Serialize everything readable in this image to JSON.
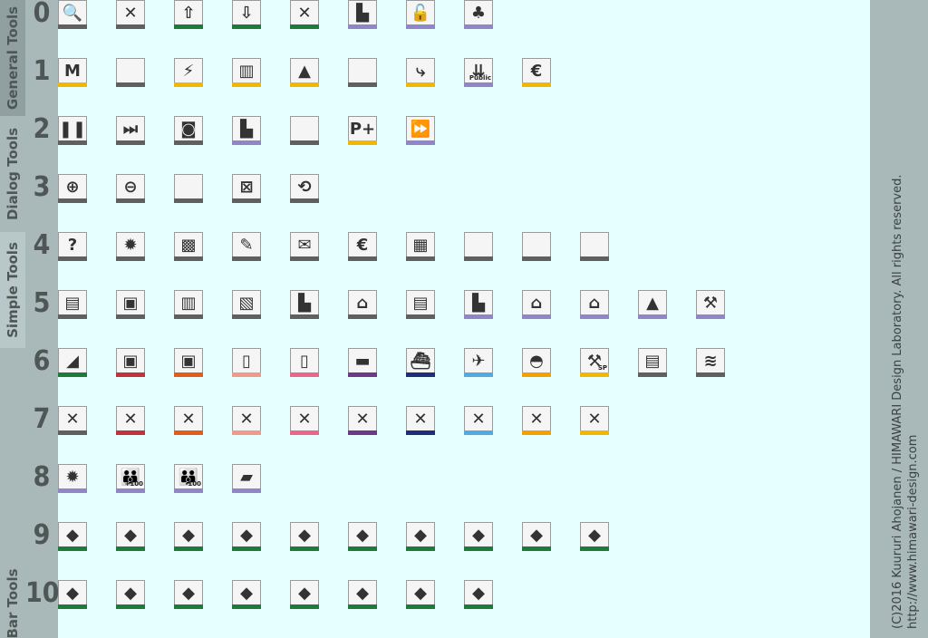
{
  "sections": [
    {
      "key": "general",
      "label": "General Tools"
    },
    {
      "key": "dialog",
      "label": "Dialog Tools"
    },
    {
      "key": "simple",
      "label": "Simple Tools"
    },
    {
      "key": "bar",
      "label": "Bar Tools"
    }
  ],
  "row_numbers": [
    "0",
    "1",
    "2",
    "3",
    "4",
    "5",
    "6",
    "7",
    "8",
    "9",
    "10"
  ],
  "copyright": {
    "line1": "(C)2016 Kuururi Ahojanen / HIMAWARI Design Laboratory. All rights reserved.",
    "line2": "http://www.himawari-design.com"
  },
  "colors": {
    "sidebar": "#a9b9b9",
    "background": "#e6ffff",
    "gray": "#606060",
    "green": "#1e7a3a",
    "purple": "#8e86c8",
    "yellow": "#f2b700",
    "red": "#c0333a",
    "orange": "#e25d1c",
    "salmon": "#f09a8a",
    "pink": "#e8678a",
    "violet": "#6b3a8a",
    "navy": "#1e2f78",
    "sky": "#55a8e0",
    "amber": "#f2a100"
  },
  "rows": [
    [
      {
        "name": "search-icon",
        "color": "gray",
        "glyph": "🔍"
      },
      {
        "name": "close-icon",
        "color": "gray",
        "glyph": "✕"
      },
      {
        "name": "raise-terrain-icon",
        "color": "green",
        "glyph": "⇧"
      },
      {
        "name": "lower-terrain-icon",
        "color": "green",
        "glyph": "⇩"
      },
      {
        "name": "remove-terrain-icon",
        "color": "green",
        "glyph": "✕"
      },
      {
        "name": "factory-link-icon",
        "color": "purple",
        "glyph": "▙"
      },
      {
        "name": "unlock-icon",
        "color": "purple",
        "glyph": "🔓"
      },
      {
        "name": "forest-icon",
        "color": "purple",
        "glyph": "♣"
      }
    ],
    [
      {
        "name": "signpost-icon",
        "color": "yellow",
        "glyph": "M"
      },
      {
        "name": "blank-icon",
        "color": "gray",
        "glyph": ""
      },
      {
        "name": "power-station-icon",
        "color": "yellow",
        "glyph": "⚡"
      },
      {
        "name": "city-add-icon",
        "color": "yellow",
        "glyph": "▥"
      },
      {
        "name": "tree-icon",
        "color": "yellow",
        "glyph": "▲"
      },
      {
        "name": "blank-icon",
        "color": "gray",
        "glyph": ""
      },
      {
        "name": "route-icon",
        "color": "yellow",
        "glyph": "⤷"
      },
      {
        "name": "public-transit-icon",
        "color": "purple",
        "glyph": "⇊",
        "sub": "Public"
      },
      {
        "name": "house-money-icon",
        "color": "yellow",
        "glyph": "€"
      }
    ],
    [
      {
        "name": "pause-icon",
        "color": "gray",
        "glyph": "❚❚"
      },
      {
        "name": "skip-forward-icon",
        "color": "gray",
        "glyph": "⏭"
      },
      {
        "name": "camera-icon",
        "color": "gray",
        "glyph": "◙"
      },
      {
        "name": "factory-add-icon",
        "color": "purple",
        "glyph": "▙"
      },
      {
        "name": "blank-icon",
        "color": "gray",
        "glyph": ""
      },
      {
        "name": "park-and-ride-icon",
        "color": "yellow",
        "glyph": "P+"
      },
      {
        "name": "fast-forward-icon",
        "color": "purple",
        "glyph": "⏩"
      }
    ],
    [
      {
        "name": "zoom-in-icon",
        "color": "gray",
        "glyph": "⊕"
      },
      {
        "name": "zoom-out-icon",
        "color": "gray",
        "glyph": "⊖"
      },
      {
        "name": "blank-icon",
        "color": "gray",
        "glyph": ""
      },
      {
        "name": "grid-icon",
        "color": "gray",
        "glyph": "⊠"
      },
      {
        "name": "rotate-view-icon",
        "color": "gray",
        "glyph": "⟲"
      }
    ],
    [
      {
        "name": "help-icon",
        "color": "gray",
        "glyph": "?"
      },
      {
        "name": "gear-icon",
        "color": "gray",
        "glyph": "✹"
      },
      {
        "name": "map-icon",
        "color": "gray",
        "glyph": "▩"
      },
      {
        "name": "edit-sign-icon",
        "color": "gray",
        "glyph": "✎"
      },
      {
        "name": "mail-icon",
        "color": "gray",
        "glyph": "✉"
      },
      {
        "name": "finance-icon",
        "color": "gray",
        "glyph": "€"
      },
      {
        "name": "chart-icon",
        "color": "gray",
        "glyph": "▦"
      },
      {
        "name": "blank-icon",
        "color": "gray",
        "glyph": ""
      },
      {
        "name": "blank-icon",
        "color": "gray",
        "glyph": ""
      },
      {
        "name": "blank-icon",
        "color": "gray",
        "glyph": ""
      }
    ],
    [
      {
        "name": "info-factory-icon",
        "color": "gray",
        "glyph": "▤"
      },
      {
        "name": "info-train-icon",
        "color": "gray",
        "glyph": "▣"
      },
      {
        "name": "info-city-icon",
        "color": "gray",
        "glyph": "▥"
      },
      {
        "name": "info-stack-icon",
        "color": "gray",
        "glyph": "▧"
      },
      {
        "name": "info-industry-icon",
        "color": "gray",
        "glyph": "▙"
      },
      {
        "name": "info-station-icon",
        "color": "gray",
        "glyph": "⌂"
      },
      {
        "name": "info-sign-icon",
        "color": "gray",
        "glyph": "▤"
      },
      {
        "name": "factory-plus-icon",
        "color": "purple",
        "glyph": "▙"
      },
      {
        "name": "station-plus-icon",
        "color": "purple",
        "glyph": "⌂"
      },
      {
        "name": "house-plus-icon",
        "color": "purple",
        "glyph": "⌂"
      },
      {
        "name": "tree-purple-icon",
        "color": "purple",
        "glyph": "▲"
      },
      {
        "name": "crane-icon",
        "color": "purple",
        "glyph": "⚒"
      }
    ],
    [
      {
        "name": "terrain-slope-icon",
        "color": "green",
        "glyph": "◢"
      },
      {
        "name": "train-icon",
        "color": "red",
        "glyph": "▣"
      },
      {
        "name": "bus-icon",
        "color": "orange",
        "glyph": "▣"
      },
      {
        "name": "tram-icon",
        "color": "salmon",
        "glyph": "▯"
      },
      {
        "name": "metro-icon",
        "color": "pink",
        "glyph": "▯"
      },
      {
        "name": "truck-icon",
        "color": "violet",
        "glyph": "▬"
      },
      {
        "name": "ship-icon",
        "color": "navy",
        "glyph": "⛴"
      },
      {
        "name": "airplane-icon",
        "color": "sky",
        "glyph": "✈"
      },
      {
        "name": "helmet-icon",
        "color": "amber",
        "glyph": "◓"
      },
      {
        "name": "construction-crane-icon",
        "color": "yellow",
        "glyph": "⚒",
        "sub": "SP"
      },
      {
        "name": "document-icon",
        "color": "gray",
        "glyph": "▤"
      },
      {
        "name": "layers-icon",
        "color": "gray",
        "glyph": "≋"
      }
    ],
    [
      {
        "name": "remove-road-icon",
        "color": "gray",
        "glyph": "✕"
      },
      {
        "name": "remove-rail-icon",
        "color": "red",
        "glyph": "✕"
      },
      {
        "name": "remove-bus-icon",
        "color": "orange",
        "glyph": "✕"
      },
      {
        "name": "remove-tram-icon",
        "color": "salmon",
        "glyph": "✕"
      },
      {
        "name": "remove-metro-icon",
        "color": "pink",
        "glyph": "✕"
      },
      {
        "name": "remove-truck-icon",
        "color": "violet",
        "glyph": "✕"
      },
      {
        "name": "remove-ship-icon",
        "color": "navy",
        "glyph": "✕"
      },
      {
        "name": "remove-air-icon",
        "color": "sky",
        "glyph": "✕"
      },
      {
        "name": "remove-helmet-icon",
        "color": "amber",
        "glyph": "✕"
      },
      {
        "name": "remove-power-icon",
        "color": "yellow",
        "glyph": "✕"
      }
    ],
    [
      {
        "name": "settings-purple-icon",
        "color": "purple",
        "glyph": "✹"
      },
      {
        "name": "population-increase-icon",
        "color": "purple",
        "glyph": "👪",
        "sub": "+100"
      },
      {
        "name": "population-decrease-icon",
        "color": "purple",
        "glyph": "👪",
        "sub": "-100"
      },
      {
        "name": "road-icon",
        "color": "purple",
        "glyph": "▰"
      }
    ],
    [
      {
        "name": "terrain-flat-icon",
        "color": "green",
        "glyph": "◆"
      },
      {
        "name": "terrain-block-icon",
        "color": "green",
        "glyph": "◆"
      },
      {
        "name": "terrain-low-icon",
        "color": "green",
        "glyph": "◆"
      },
      {
        "name": "terrain-raised-icon",
        "color": "green",
        "glyph": "◆"
      },
      {
        "name": "terrain-cube-icon",
        "color": "green",
        "glyph": "◆"
      },
      {
        "name": "terrain-corner-icon",
        "color": "green",
        "glyph": "◆"
      },
      {
        "name": "terrain-slope-up-icon",
        "color": "green",
        "glyph": "◆"
      },
      {
        "name": "terrain-cliff-icon",
        "color": "green",
        "glyph": "◆"
      },
      {
        "name": "terrain-edge-icon",
        "color": "green",
        "glyph": "◆"
      },
      {
        "name": "terrain-hill-icon",
        "color": "green",
        "glyph": "◆"
      }
    ],
    [
      {
        "name": "water-tile-icon",
        "color": "green",
        "glyph": "◆"
      },
      {
        "name": "sand-tile-icon",
        "color": "green",
        "glyph": "◆"
      },
      {
        "name": "light-grass-tile-icon",
        "color": "green",
        "glyph": "◆"
      },
      {
        "name": "grass-tile-icon",
        "color": "green",
        "glyph": "◆"
      },
      {
        "name": "dark-green-tile-icon",
        "color": "green",
        "glyph": "◆"
      },
      {
        "name": "dirt-tile-icon",
        "color": "green",
        "glyph": "◆"
      },
      {
        "name": "mud-tile-icon",
        "color": "green",
        "glyph": "◆"
      },
      {
        "name": "rock-tile-icon",
        "color": "green",
        "glyph": "◆"
      }
    ]
  ]
}
